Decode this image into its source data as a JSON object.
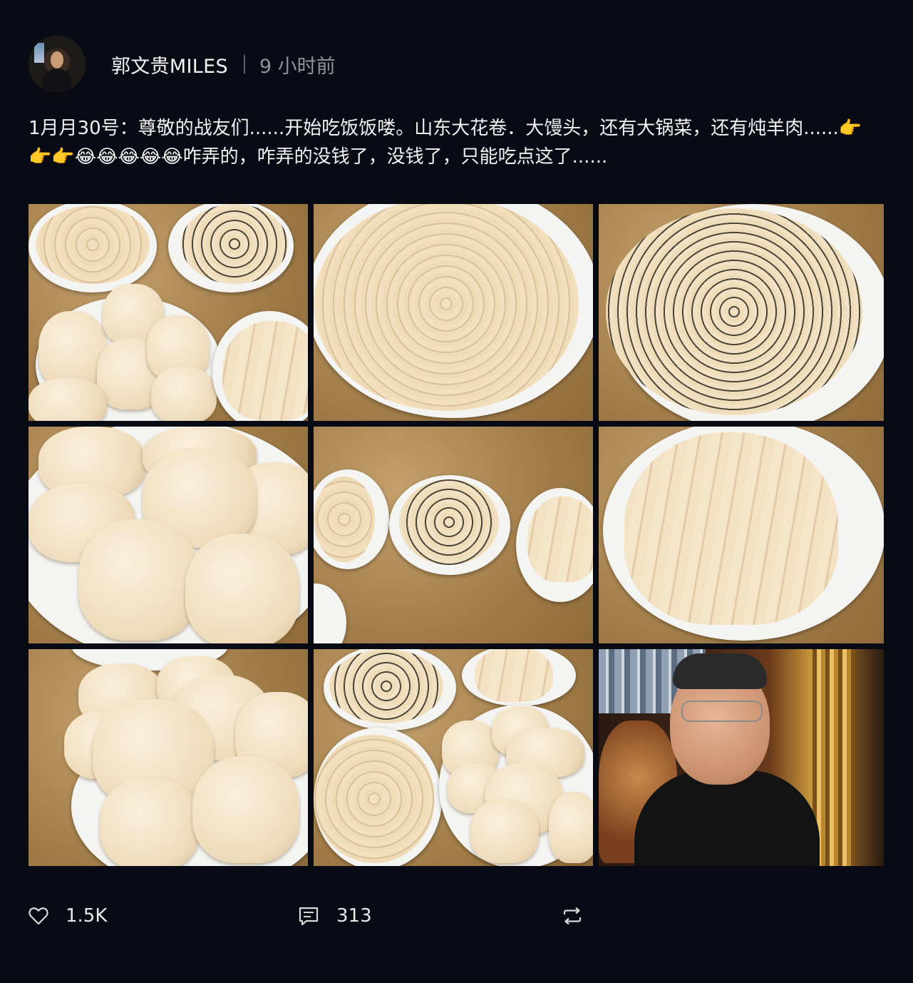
{
  "post": {
    "author": "郭文贵MILES",
    "time": "9 小时前",
    "text": "1月月30号：尊敬的战友们......开始吃饭饭喽。山东大花卷．大馒头，还有大锅菜，还有炖羊肉......👉👉👉😂😂😂😂😂咋弄的，咋弄的没钱了，没钱了，只能吃点这了......"
  },
  "images": [
    {
      "icon": "flower-rolls-and-buns-photo"
    },
    {
      "icon": "plain-flower-roll-photo"
    },
    {
      "icon": "dark-flower-roll-photo"
    },
    {
      "icon": "steamed-buns-photo"
    },
    {
      "icon": "three-plates-photo"
    },
    {
      "icon": "folded-roll-photo"
    },
    {
      "icon": "steamed-buns-closeup-photo"
    },
    {
      "icon": "rolls-and-buns-photo"
    },
    {
      "icon": "selfie-photo"
    }
  ],
  "actions": {
    "likes": "1.5K",
    "comments": "313"
  },
  "colors": {
    "background": "#080b13",
    "text": "#f2f2f2",
    "muted": "#8f949b"
  }
}
